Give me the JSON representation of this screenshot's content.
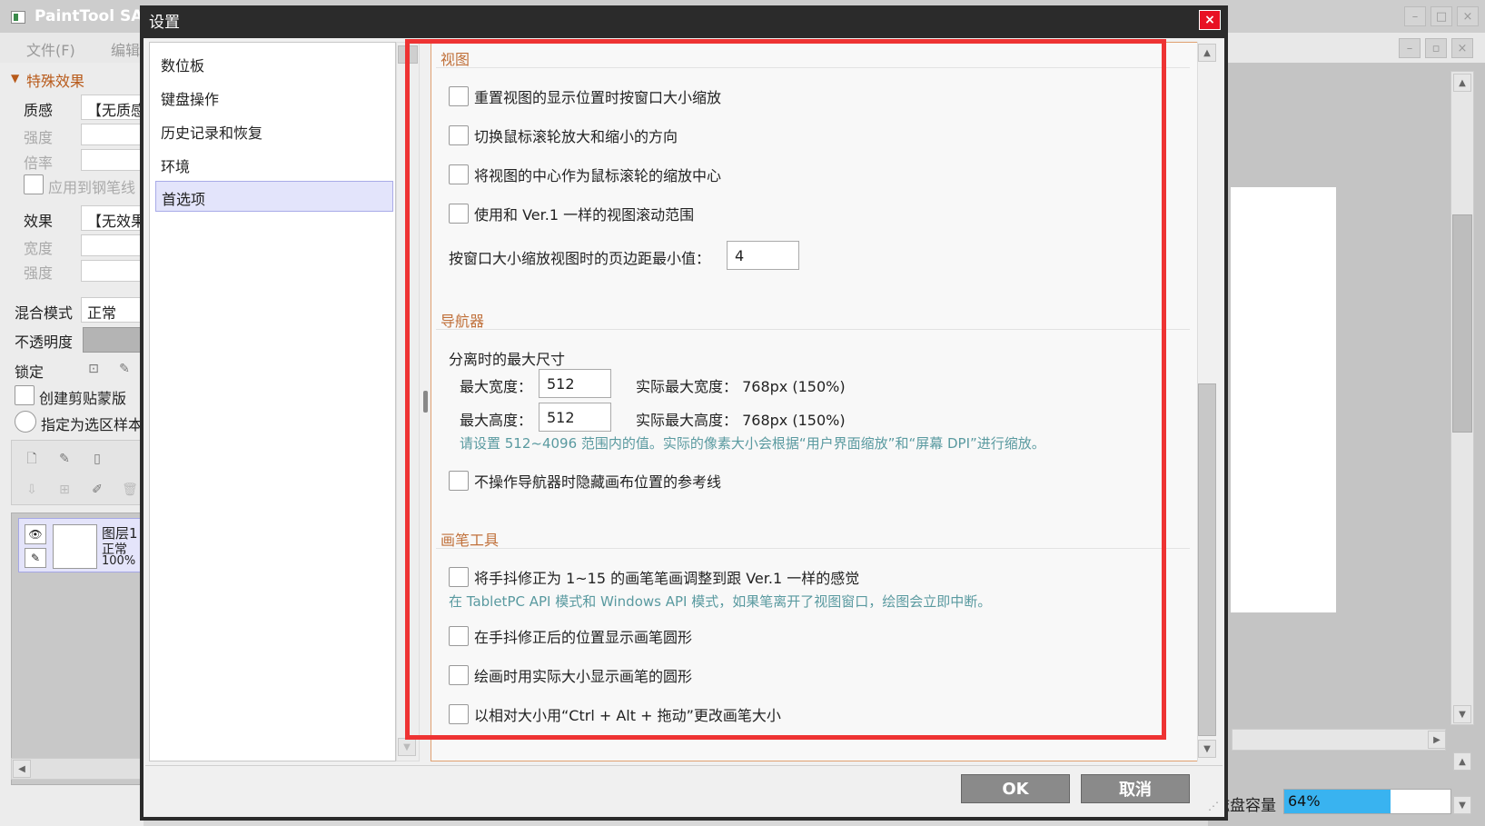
{
  "app": {
    "title": "PaintTool SAI",
    "menu": [
      "文件(F)",
      "编辑"
    ],
    "left_panel": {
      "section": "特殊效果",
      "texture_label": "质感",
      "texture_value": "【无质感】",
      "strength_label": "强度",
      "scale_label": "倍率",
      "apply_pen_label": "应用到钢笔线",
      "effect_label": "效果",
      "effect_value": "【无效果】",
      "width_label": "宽度",
      "strength2_label": "强度",
      "blend_label": "混合模式",
      "blend_value": "正常",
      "opacity_label": "不透明度",
      "lock_label": "锁定",
      "clip_label": "创建剪贴蒙版",
      "selection_label": "指定为选区样本",
      "layer_name": "图层1",
      "layer_mode": "正常",
      "layer_opacity": "100%"
    },
    "disk_label": "磁盘容量",
    "disk_value": "64%",
    "disk_level": 0.64
  },
  "dialog": {
    "title": "设置",
    "nav": [
      "数位板",
      "键盘操作",
      "历史记录和恢复",
      "环境",
      "首选项"
    ],
    "selected_nav": "首选项",
    "sections": {
      "view": {
        "title": "视图",
        "options": [
          "重置视图的显示位置时按窗口大小缩放",
          "切换鼠标滚轮放大和缩小的方向",
          "将视图的中心作为鼠标滚轮的缩放中心",
          "使用和 Ver.1 一样的视图滚动范围"
        ],
        "margin_label": "按窗口大小缩放视图时的页边距最小值：",
        "margin_value": "4"
      },
      "navigator": {
        "title": "导航器",
        "max_size_label": "分离时的最大尺寸",
        "max_width_label": "最大宽度：",
        "max_width_value": "512",
        "actual_width": "实际最大宽度： 768px (150%)",
        "max_height_label": "最大高度：",
        "max_height_value": "512",
        "actual_height": "实际最大高度： 768px (150%)",
        "hint": "请设置 512~4096 范围内的值。实际的像素大小会根据“用户界面缩放”和“屏幕 DPI”进行缩放。",
        "hide_guides": "不操作导航器时隐藏画布位置的参考线"
      },
      "brush": {
        "title": "画笔工具",
        "stabilizer": "将手抖修正为 1~15 的画笔笔画调整到跟 Ver.1 一样的感觉",
        "stabilizer_hint": "在 TabletPC API 模式和 Windows API 模式，如果笔离开了视图窗口，绘图会立即中断。",
        "show_circle": "在手抖修正后的位置显示画笔圆形",
        "actual_size": "绘画时用实际大小显示画笔的圆形",
        "resize": "以相对大小用“Ctrl + Alt + 拖动”更改画笔大小"
      }
    },
    "ok_label": "OK",
    "cancel_label": "取消"
  }
}
